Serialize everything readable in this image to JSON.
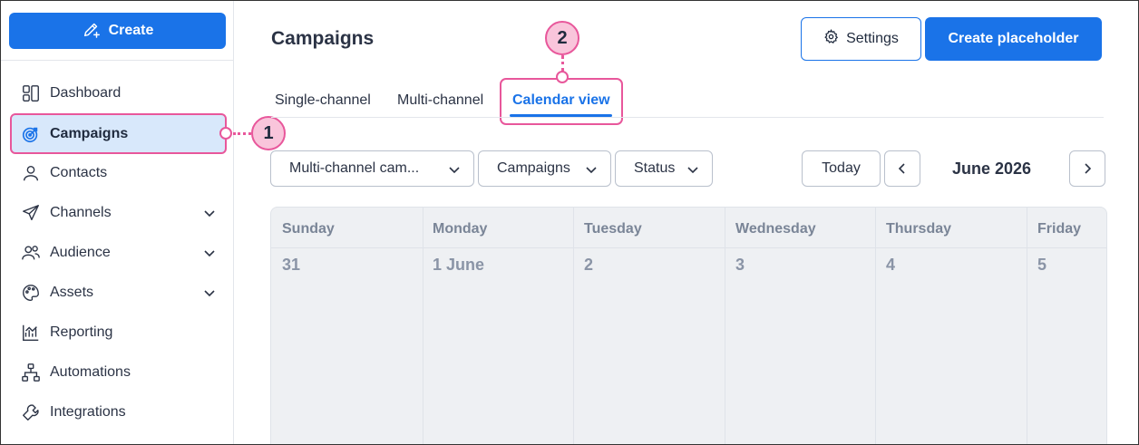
{
  "sidebar": {
    "create_label": "Create",
    "items": [
      {
        "label": "Dashboard",
        "icon": "dashboard-icon",
        "chevron": false
      },
      {
        "label": "Campaigns",
        "icon": "target-icon",
        "chevron": false,
        "active": true
      },
      {
        "label": "Contacts",
        "icon": "person-icon",
        "chevron": false
      },
      {
        "label": "Channels",
        "icon": "paper-plane-icon",
        "chevron": true
      },
      {
        "label": "Audience",
        "icon": "people-icon",
        "chevron": true
      },
      {
        "label": "Assets",
        "icon": "palette-icon",
        "chevron": true
      },
      {
        "label": "Reporting",
        "icon": "chart-icon",
        "chevron": false
      },
      {
        "label": "Automations",
        "icon": "hierarchy-icon",
        "chevron": false
      },
      {
        "label": "Integrations",
        "icon": "wrench-icon",
        "chevron": false
      }
    ]
  },
  "header": {
    "title": "Campaigns",
    "settings_label": "Settings",
    "create_placeholder_label": "Create placeholder"
  },
  "tabs": [
    {
      "label": "Single-channel"
    },
    {
      "label": "Multi-channel"
    },
    {
      "label": "Calendar view",
      "active": true
    }
  ],
  "filters": [
    {
      "label": "Multi-channel cam..."
    },
    {
      "label": "Campaigns"
    },
    {
      "label": "Status"
    }
  ],
  "calendar": {
    "today_label": "Today",
    "month": "June 2026",
    "days": [
      "Sunday",
      "Monday",
      "Tuesday",
      "Wednesday",
      "Thursday",
      "Friday"
    ],
    "dates": [
      "31",
      "1 June",
      "2",
      "3",
      "4",
      "5"
    ]
  },
  "callouts": [
    "1",
    "2"
  ],
  "colors": {
    "accent": "#1a73e8",
    "callout_border": "#e8579b",
    "callout_fill": "#f9c5db",
    "active_nav_bg": "#d8e8fb"
  }
}
